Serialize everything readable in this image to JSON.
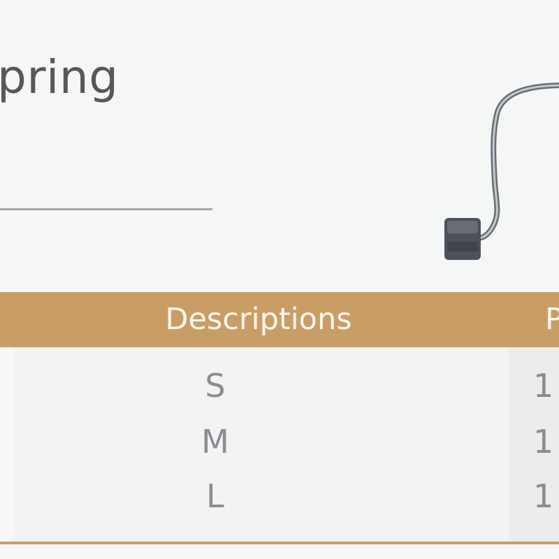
{
  "product": {
    "title": "pring",
    "image_name": "hook-product-image"
  },
  "table": {
    "headers": [
      "Descriptions",
      "P"
    ],
    "rows": [
      {
        "size": "S",
        "next": "1"
      },
      {
        "size": "M",
        "next": "1"
      },
      {
        "size": "L",
        "next": "1"
      }
    ]
  },
  "colors": {
    "header_bg": "#c99e66",
    "title_text": "#565759",
    "cell_text": "#8a8c92"
  }
}
